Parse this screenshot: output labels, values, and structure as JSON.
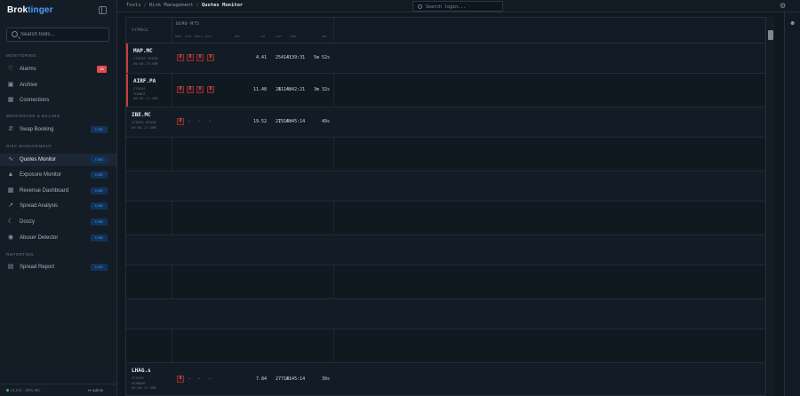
{
  "brand": {
    "part1": "Brok",
    "part2": "tinger"
  },
  "sidebar": {
    "search_placeholder": "Search tools...",
    "sections": [
      {
        "title": "MONITORING",
        "items": [
          {
            "label": "Alarms",
            "icon": "bell-icon",
            "badge": "26",
            "badge_color": "#e5484d"
          },
          {
            "label": "Archive",
            "icon": "archive-icon"
          },
          {
            "label": "Connections",
            "icon": "connections-icon"
          }
        ]
      },
      {
        "title": "BROKERAGE & BILLING",
        "items": [
          {
            "label": "Swap Booking",
            "icon": "swap-icon",
            "badge": "LIVE"
          }
        ]
      },
      {
        "title": "RISK MANAGEMENT",
        "items": [
          {
            "label": "Quotes Monitor",
            "icon": "pulse-icon",
            "badge": "LIVE",
            "active": true
          },
          {
            "label": "Exposure Monitor",
            "icon": "shield-icon",
            "badge": "LIVE"
          },
          {
            "label": "Revenue Dashboard",
            "icon": "chart-icon",
            "badge": "LIVE"
          },
          {
            "label": "Spread Analysis",
            "icon": "trend-icon",
            "badge": "LIVE"
          },
          {
            "label": "Doozy",
            "icon": "moon-icon",
            "badge": "LIVE"
          },
          {
            "label": "Abuser Detector",
            "icon": "detector-icon",
            "badge": "LIVE"
          }
        ]
      },
      {
        "title": "REPORTING",
        "items": [
          {
            "label": "Spread Report",
            "icon": "report-icon",
            "badge": "LIVE"
          }
        ]
      }
    ],
    "footer": {
      "status": "v1.0.0 · 20% MC",
      "user": "admin"
    }
  },
  "topbar": {
    "breadcrumb": [
      "Tools",
      "Risk Management",
      "Quotes Monitor"
    ],
    "search_placeholder": "Search login..."
  },
  "grid": {
    "symbol_header": "SYMBOL",
    "group_header": "DEMO-MT5",
    "sub_headers": [
      "DEMO",
      "LIVE",
      "PRE-S",
      "POST",
      "BID",
      "ASK",
      "LAST",
      "TIME",
      "AGE"
    ],
    "rows": [
      {
        "symbol": "MAP.MC",
        "meta": [
          "STOCKS SPAIN",
          "09:00-17:30M"
        ],
        "flags": [
          "X",
          "X",
          "X",
          "X"
        ],
        "bid": "4.41",
        "ask": "4.41",
        "time": "25 14:39:31",
        "age": "5m 52s",
        "flagged": true
      },
      {
        "symbol": "AIRF.PA",
        "meta": [
          "STOCKS",
          "FRANCE",
          "09:00-17:30M"
        ],
        "flags": [
          "X",
          "X",
          "X",
          "X"
        ],
        "bid": "11.48",
        "ask": "11.48",
        "time": "28 14:42:21",
        "age": "3m 32s",
        "flagged": true
      },
      {
        "symbol": "IBE.MC",
        "meta": [
          "STOCKS SPAIN",
          "09:00-17:30M"
        ],
        "flags": [
          "X"
        ],
        "bid": "19.52",
        "ask": "19.69",
        "time": "27 14:45:14",
        "age": "49s",
        "flagged": false
      },
      {
        "symbol": "LHAG.s",
        "meta": [
          "STOCKS",
          "GERMANY",
          "09:00-17:30M"
        ],
        "flags": [
          "X"
        ],
        "bid": "7.84",
        "ask": "7.81",
        "time": "27 14:45:14",
        "age": "39s",
        "flagged": false
      }
    ]
  }
}
